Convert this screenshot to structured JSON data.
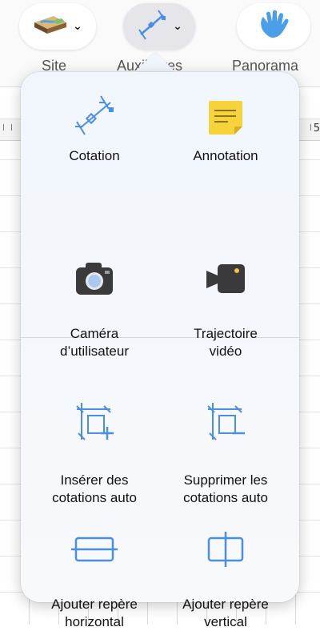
{
  "toolbar": {
    "site_label": "Site",
    "auxiliaires_label": "Auxiliaires",
    "panorama_label": "Panorama"
  },
  "ruler": {
    "label": "5"
  },
  "menu": {
    "items": [
      {
        "label": "Cotation",
        "icon": "dimension-icon"
      },
      {
        "label": "Annotation",
        "icon": "note-icon"
      },
      {
        "label": "Caméra\nd’utilisateur",
        "icon": "camera-icon"
      },
      {
        "label": "Trajectoire\nvidéo",
        "icon": "video-camera-icon"
      },
      {
        "label": "Insérer des\ncotations auto",
        "icon": "auto-dimension-add-icon"
      },
      {
        "label": "Supprimer les\ncotations auto",
        "icon": "auto-dimension-remove-icon"
      },
      {
        "label": "Ajouter repère\nhorizontal",
        "icon": "horizontal-guide-icon"
      },
      {
        "label": "Ajouter repère\nvertical",
        "icon": "vertical-guide-icon"
      }
    ]
  },
  "colors": {
    "accent": "#4a8ee6",
    "note_yellow": "#f6d33b",
    "camera_dark": "#3a3a3c"
  }
}
